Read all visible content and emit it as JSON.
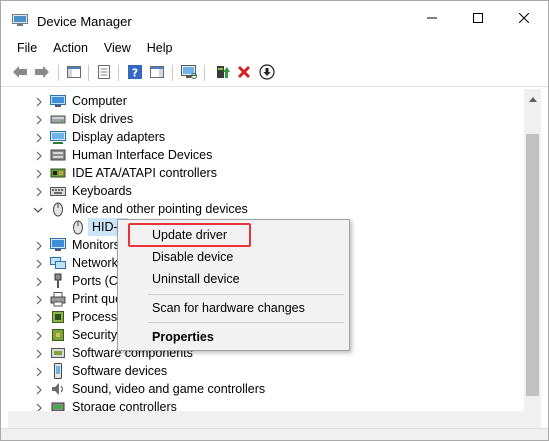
{
  "window": {
    "title": "Device Manager",
    "icons": {
      "app": "device-manager-icon",
      "minimize": "minimize-icon",
      "maximize": "maximize-icon",
      "close": "close-icon"
    }
  },
  "menu": {
    "items": [
      {
        "label": "File"
      },
      {
        "label": "Action"
      },
      {
        "label": "View"
      },
      {
        "label": "Help"
      }
    ]
  },
  "toolbar": {
    "buttons": [
      {
        "name": "back-button",
        "icon": "back-arrow-icon"
      },
      {
        "name": "forward-button",
        "icon": "forward-arrow-icon"
      },
      {
        "name": "show-hide-console-tree-button",
        "icon": "console-tree-icon"
      },
      {
        "name": "properties-button",
        "icon": "properties-icon"
      },
      {
        "name": "help-button",
        "icon": "help-icon"
      },
      {
        "name": "action-pane-button",
        "icon": "action-pane-icon"
      },
      {
        "name": "scan-hardware-button",
        "icon": "monitor-scan-icon"
      },
      {
        "name": "update-driver-button",
        "icon": "update-driver-icon"
      },
      {
        "name": "uninstall-device-button",
        "icon": "red-x-icon"
      },
      {
        "name": "disable-device-button",
        "icon": "disable-down-arrow-icon"
      }
    ]
  },
  "tree": {
    "items": [
      {
        "label": "Computer",
        "icon": "computer-icon",
        "expanded": false
      },
      {
        "label": "Disk drives",
        "icon": "disk-drive-icon",
        "expanded": false
      },
      {
        "label": "Display adapters",
        "icon": "display-adapter-icon",
        "expanded": false
      },
      {
        "label": "Human Interface Devices",
        "icon": "hid-icon",
        "expanded": false
      },
      {
        "label": "IDE ATA/ATAPI controllers",
        "icon": "ide-controller-icon",
        "expanded": false
      },
      {
        "label": "Keyboards",
        "icon": "keyboard-icon",
        "expanded": false
      },
      {
        "label": "Mice and other pointing devices",
        "icon": "mouse-icon",
        "expanded": true
      },
      {
        "label": "HID-",
        "icon": "mouse-icon",
        "child": true,
        "selected": true
      },
      {
        "label": "Monitors",
        "icon": "monitor-icon",
        "expanded": false
      },
      {
        "label": "Network",
        "icon": "network-adapter-icon",
        "expanded": false
      },
      {
        "label": "Ports (CO",
        "icon": "ports-icon",
        "expanded": false
      },
      {
        "label": "Print que",
        "icon": "printer-icon",
        "expanded": false
      },
      {
        "label": "Processo",
        "icon": "processor-icon",
        "expanded": false
      },
      {
        "label": "Security",
        "icon": "security-device-icon",
        "expanded": false
      },
      {
        "label": "Software components",
        "icon": "software-component-icon",
        "expanded": false
      },
      {
        "label": "Software devices",
        "icon": "software-device-icon",
        "expanded": false
      },
      {
        "label": "Sound, video and game controllers",
        "icon": "sound-icon",
        "expanded": false
      },
      {
        "label": "Storage controllers",
        "icon": "storage-controller-icon",
        "expanded": false
      }
    ]
  },
  "context_menu": {
    "items": [
      {
        "label": "Update driver",
        "highlighted": true
      },
      {
        "label": "Disable device"
      },
      {
        "label": "Uninstall device"
      },
      {
        "separator": true
      },
      {
        "label": "Scan for hardware changes"
      },
      {
        "separator": true
      },
      {
        "label": "Properties",
        "bold": true
      }
    ],
    "highlight_color": "#e8323c"
  },
  "colors": {
    "selection": "#cce4f7",
    "scroll_thumb": "#c1c1c1"
  }
}
